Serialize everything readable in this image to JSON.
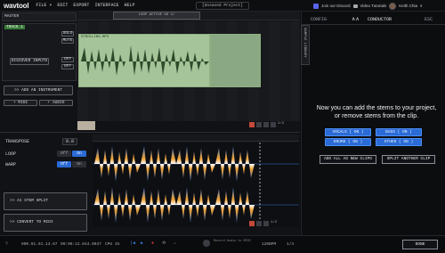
{
  "app": {
    "logo": "wavtool"
  },
  "menu": [
    "FILE ▾",
    "EDIT",
    "EXPORT",
    "INTERFACE",
    "HELP"
  ],
  "project": {
    "title": "[Unsaved Project]"
  },
  "topright": {
    "discord": "Join our Discord",
    "tutorials": "Video Tutorials",
    "user": "Keith Chia"
  },
  "tracks": {
    "master_label": "MASTER",
    "track_label": "TRACK 1",
    "solo": "SOLO",
    "mute": "MUTE",
    "discover_inputs": "DISCOVER INPUTS",
    "off1": "OFF",
    "off2": "OFF",
    "add_instrument": ">> ADD AN INSTRUMENT",
    "add_midi": "+ MIDI",
    "add_audio": "+ AUDIO",
    "loop_label": "LOOP ACTIVE 50 1/",
    "clip_name": "STROLLING.MP3",
    "page": "1/2"
  },
  "editor": {
    "transpose_label": "TRANSPOSE",
    "transpose_value": "0.0",
    "loop_label": "LOOP",
    "loop_off": "Off",
    "loop_on": "On",
    "warp_label": "WARP",
    "warp_off": "Off",
    "warp_on": "On",
    "ai_stem_split": ">> AI STEM SPLIT",
    "convert_to_midi": ">> CONVERT TO MIDI",
    "page": "1/2"
  },
  "conductor": {
    "config_tab": "CONFIG",
    "conductor_tab": "CONDUCTOR",
    "esc": "ESC",
    "side_label": "SAMPLE LIBRARY",
    "message": "Now you can add the stems to your project, or remove stems from the clip.",
    "stems": [
      {
        "label": "VOCALS ( ON )"
      },
      {
        "label": "BASS ( ON )"
      },
      {
        "label": "DRUMS ( ON )"
      },
      {
        "label": "OTHER ( ON )"
      }
    ],
    "add_all": "ADD ALL AS NEW CLIPS",
    "split_another": "SPLIT ANOTHER CLIP",
    "done": "DONE"
  },
  "transport": {
    "position": "000.01.01.13.67",
    "time": "00:00:12.044.0037",
    "cpu": "CPU 1%",
    "bpm": "120BPM",
    "meter": "1/4",
    "record_hint": "Record Audio to MIDI"
  },
  "colors": {
    "accent_blue": "#2a6bd6",
    "clip_green": "#a6c49a",
    "record_red": "#d23a3a"
  }
}
